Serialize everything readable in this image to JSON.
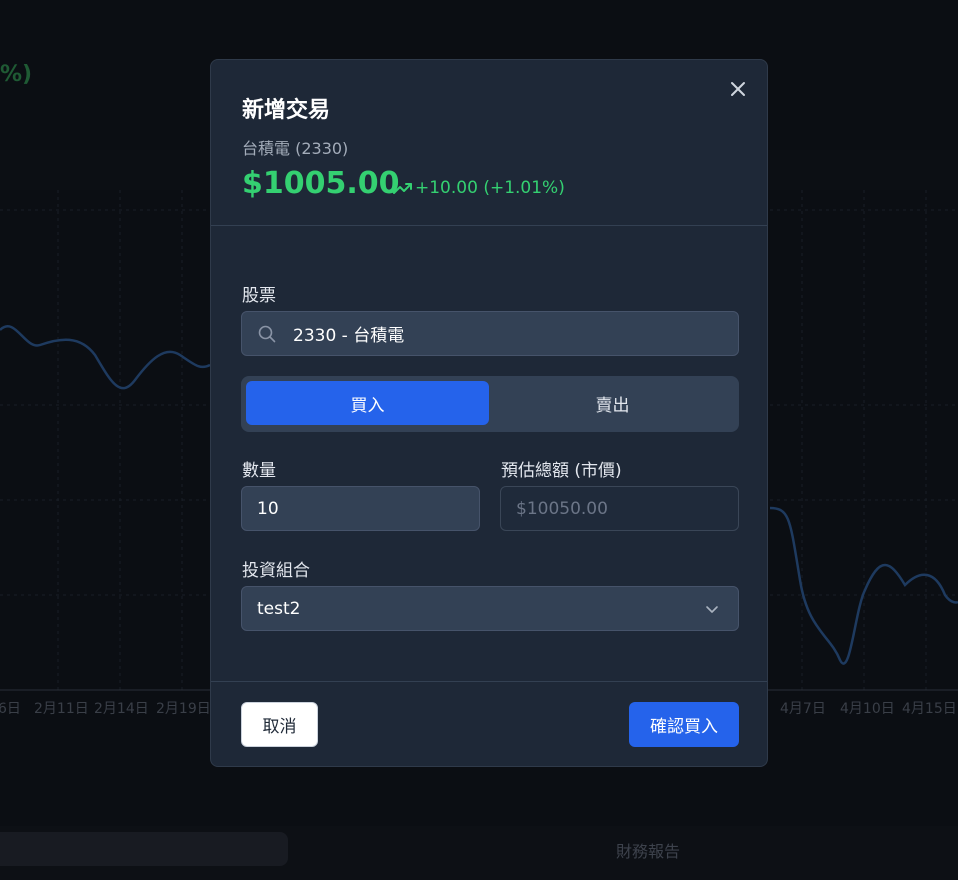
{
  "background": {
    "percent_fragment": "%)",
    "x_tick_labels": [
      "6日",
      "2月11日",
      "2月14日",
      "2月19日",
      "4月7日",
      "4月10日",
      "4月15日"
    ],
    "tab_right_label": "財務報告"
  },
  "modal": {
    "title": "新增交易",
    "stock_name": "台積電 (2330)",
    "price": "$1005.00",
    "change": "+10.00 (+1.01%)",
    "stock_label": "股票",
    "stock_value": "2330 - 台積電",
    "buy_label": "買入",
    "sell_label": "賣出",
    "quantity_label": "數量",
    "quantity_value": "10",
    "estimate_label": "預估總額 (市價)",
    "estimate_value": "$10050.00",
    "portfolio_label": "投資組合",
    "portfolio_value": "test2",
    "cancel_label": "取消",
    "confirm_label": "確認買入"
  },
  "colors": {
    "accent": "#2563eb",
    "positive": "#34d071",
    "modal_bg": "#1e2837"
  }
}
